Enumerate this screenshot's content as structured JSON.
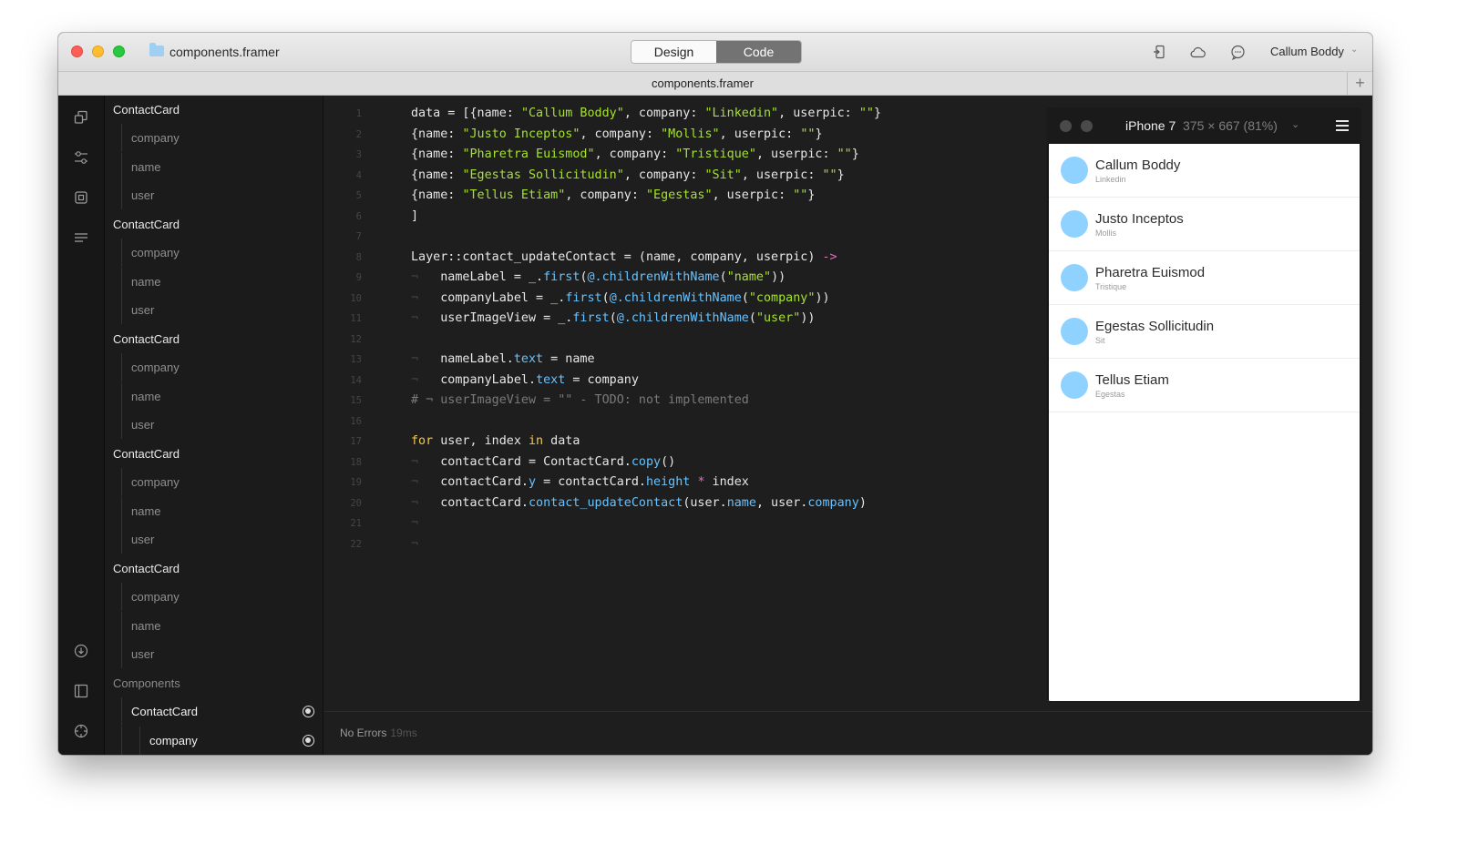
{
  "window": {
    "file_title": "components.framer",
    "tab_title": "components.framer",
    "mode_design": "Design",
    "mode_code": "Code",
    "user_name": "Callum Boddy",
    "colors": {
      "accent_code_tab": "#737373",
      "string": "#a6e22e",
      "keyword": "#f2c94c",
      "function": "#66c2ff",
      "operator": "#e96bc0"
    }
  },
  "toolbar_icons": [
    "mirror-device-icon",
    "cloud-icon",
    "comment-icon"
  ],
  "rail_icons": [
    "layers-icon",
    "properties-icon",
    "components-icon",
    "text-list-icon",
    "import-icon",
    "panel-icon",
    "target-icon"
  ],
  "layers": {
    "groups": [
      {
        "name": "ContactCard",
        "children": [
          "company",
          "name",
          "user"
        ]
      },
      {
        "name": "ContactCard",
        "children": [
          "company",
          "name",
          "user"
        ]
      },
      {
        "name": "ContactCard",
        "children": [
          "company",
          "name",
          "user"
        ]
      },
      {
        "name": "ContactCard",
        "children": [
          "company",
          "name",
          "user"
        ]
      },
      {
        "name": "ContactCard",
        "children": [
          "company",
          "name",
          "user"
        ]
      }
    ],
    "section_label": "Components",
    "selected": {
      "name": "ContactCard",
      "child": "company"
    }
  },
  "code": {
    "line_numbers": [
      "1",
      "2",
      "3",
      "4",
      "5",
      "6",
      "7",
      "8",
      "9",
      "10",
      "11",
      "12",
      "13",
      "14",
      "15",
      "16",
      "17",
      "18",
      "19",
      "20",
      "21",
      "22"
    ],
    "strings": {
      "callum": "\"Callum Boddy\"",
      "linkedin": "\"Linkedin\"",
      "justo": "\"Justo Inceptos\"",
      "mollis": "\"Mollis\"",
      "pharetra": "\"Pharetra Euismod\"",
      "tristique": "\"Tristique\"",
      "egestas_s": "\"Egestas Sollicitudin\"",
      "sit": "\"Sit\"",
      "tellus": "\"Tellus Etiam\"",
      "egestas": "\"Egestas\"",
      "empty": "\"\"",
      "name": "\"name\"",
      "company": "\"company\"",
      "user": "\"user\""
    },
    "comment_line": "# ¬ userImageView = \"\" - TODO: not implemented"
  },
  "status": {
    "text": "No Errors",
    "time": "19ms"
  },
  "preview": {
    "device_name": "iPhone 7",
    "device_size": "375 × 667 (81%)",
    "contacts": [
      {
        "name": "Callum Boddy",
        "company": "Linkedin"
      },
      {
        "name": "Justo Inceptos",
        "company": "Mollis"
      },
      {
        "name": "Pharetra Euismod",
        "company": "Tristique"
      },
      {
        "name": "Egestas Sollicitudin",
        "company": "Sit"
      },
      {
        "name": "Tellus Etiam",
        "company": "Egestas"
      }
    ],
    "avatar_color": "#8fd2ff"
  }
}
